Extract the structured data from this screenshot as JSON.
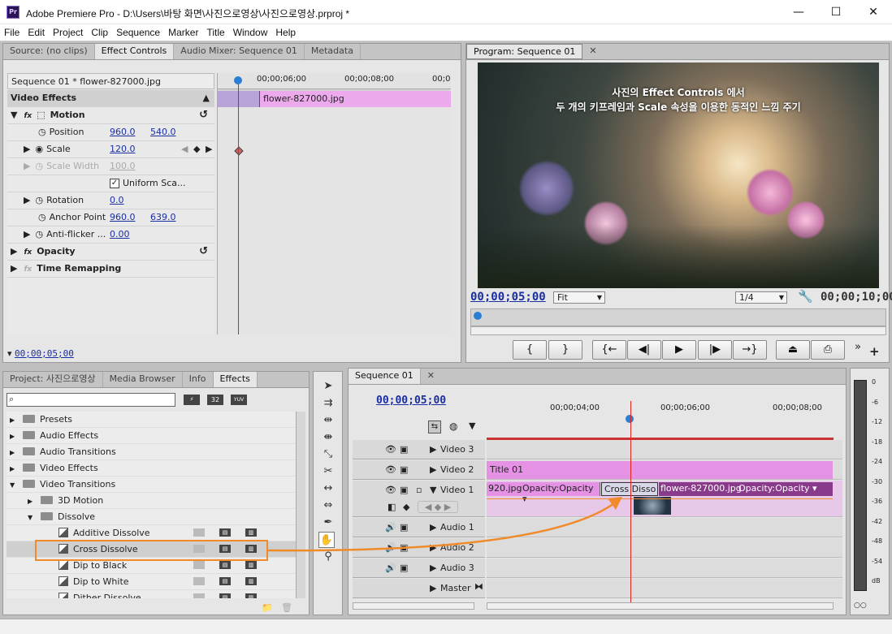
{
  "window": {
    "title": "Adobe Premiere Pro - D:\\Users\\바탕 화면\\사진으로영상\\사진으로영상.prproj *",
    "logo": "Pr",
    "minimize": "—",
    "maximize": "☐",
    "close": "✕"
  },
  "menu": [
    "File",
    "Edit",
    "Project",
    "Clip",
    "Sequence",
    "Marker",
    "Title",
    "Window",
    "Help"
  ],
  "source_panel": {
    "tabs": [
      "Source: (no clips)",
      "Effect Controls",
      "Audio Mixer: Sequence 01",
      "Metadata"
    ],
    "clip_name": "Sequence 01 * flower-827000.jpg",
    "ruler": [
      "00;00;06;00",
      "00;00;08;00",
      "00;0"
    ],
    "timeline_clip": "flower-827000.jpg",
    "video_effects": "Video Effects",
    "motion": "Motion",
    "position": {
      "label": "Position",
      "x": "960.0",
      "y": "540.0"
    },
    "scale": {
      "label": "Scale",
      "value": "120.0"
    },
    "scale_width": {
      "label": "Scale Width",
      "value": "100.0"
    },
    "uniform": "Uniform Sca...",
    "rotation": {
      "label": "Rotation",
      "value": "0.0"
    },
    "anchor": {
      "label": "Anchor Point",
      "x": "960.0",
      "y": "639.0"
    },
    "antiflicker": {
      "label": "Anti-flicker ...",
      "value": "0.00"
    },
    "opacity": "Opacity",
    "time_remap": "Time Remapping",
    "timecode": "00;00;05;00"
  },
  "program": {
    "tab": "Program: Sequence 01",
    "caption1": "사진의 Effect Controls 에서",
    "caption2": "두 개의 키프레임과 Scale 속성을 이용한 동적인 느낌 주기",
    "timecode": "00;00;05;00",
    "fit": "Fit",
    "res": "1/4",
    "duration": "00;00;10;00",
    "buttons": [
      "{",
      "}",
      "{←",
      "◀|",
      "▶",
      "|▶",
      "→}",
      "⏏",
      "⎙"
    ]
  },
  "project_panel": {
    "tabs": [
      "Project: 사진으로영상",
      "Media Browser",
      "Info",
      "Effects"
    ],
    "badges": [
      "32",
      "YUV"
    ],
    "tree": [
      {
        "label": "Presets",
        "indent": 0,
        "kind": "folder",
        "arrow": "▶"
      },
      {
        "label": "Audio Effects",
        "indent": 0,
        "kind": "folder",
        "arrow": "▶"
      },
      {
        "label": "Audio Transitions",
        "indent": 0,
        "kind": "folder",
        "arrow": "▶"
      },
      {
        "label": "Video Effects",
        "indent": 0,
        "kind": "folder",
        "arrow": "▶"
      },
      {
        "label": "Video Transitions",
        "indent": 0,
        "kind": "folder",
        "arrow": "▼"
      },
      {
        "label": "3D Motion",
        "indent": 1,
        "kind": "folder",
        "arrow": "▶"
      },
      {
        "label": "Dissolve",
        "indent": 1,
        "kind": "folder",
        "arrow": "▼"
      },
      {
        "label": "Additive Dissolve",
        "indent": 2,
        "kind": "trans",
        "arrow": ""
      },
      {
        "label": "Cross Dissolve",
        "indent": 2,
        "kind": "trans",
        "arrow": "",
        "selected": true
      },
      {
        "label": "Dip to Black",
        "indent": 2,
        "kind": "trans",
        "arrow": ""
      },
      {
        "label": "Dip to White",
        "indent": 2,
        "kind": "trans",
        "arrow": ""
      },
      {
        "label": "Dither Dissolve",
        "indent": 2,
        "kind": "trans",
        "arrow": ""
      }
    ]
  },
  "sequence": {
    "tab": "Sequence 01",
    "timecode": "00;00;05;00",
    "ruler": [
      "00;00;04;00",
      "00;00;06;00",
      "00;00;08;00"
    ],
    "tracks": [
      "Video 3",
      "Video 2",
      "Video 1",
      "Audio 1",
      "Audio 2",
      "Audio 3",
      "Master"
    ],
    "title_clip": "Title 01",
    "clip_a": "920.jpg",
    "clip_a_opacity": "Opacity:Opacity ▾",
    "transition": "Cross Disso",
    "clip_b": "flower-827000.jpg",
    "clip_b_opacity": "Opacity:Opacity ▾"
  },
  "meter": {
    "scale": [
      "0",
      "-6",
      "-12",
      "-18",
      "-24",
      "-30",
      "-36",
      "-42",
      "-48",
      "-54",
      "dB"
    ]
  },
  "colors": {
    "clip_pink": "#e592e5",
    "highlight": "#f08a2a",
    "playhead": "#d22",
    "timecode": "#1a2ea3"
  }
}
